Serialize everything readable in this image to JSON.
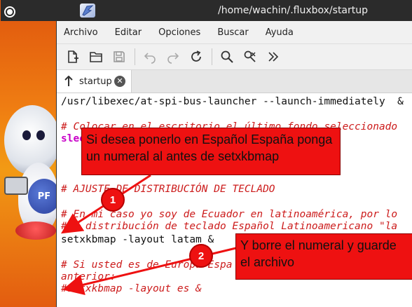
{
  "window": {
    "title": "/home/wachin/.fluxbox/startup"
  },
  "menubar": {
    "items": [
      "Archivo",
      "Editar",
      "Opciones",
      "Buscar",
      "Ayuda"
    ]
  },
  "toolbar": {
    "icons": [
      "new-file-icon",
      "open-folder-icon",
      "save-icon",
      "undo-icon",
      "redo-icon",
      "reload-icon",
      "search-icon",
      "find-replace-icon",
      "more-icon"
    ]
  },
  "tab": {
    "label": "startup",
    "close_glyph": "✕"
  },
  "editor": {
    "lines": [
      {
        "text": "/usr/libexec/at-spi-bus-launcher --launch-immediately  &",
        "style": "plain"
      },
      {
        "text": "",
        "style": "plain"
      },
      {
        "text": "# Colocar en el escritorio el último fondo seleccionado",
        "style": "comment"
      },
      {
        "text": "sleep",
        "style": "kw"
      },
      {
        "text": "",
        "style": "plain"
      },
      {
        "text": "",
        "style": "plain"
      },
      {
        "text": "",
        "style": "plain"
      },
      {
        "text": "# AJUSTE DE DISTRIBUCIÓN DE TECLADO",
        "style": "comment"
      },
      {
        "text": "",
        "style": "plain"
      },
      {
        "text": "# En mi caso yo soy de Ecuador en latinoamérica, por lo",
        "style": "comment"
      },
      {
        "text": "#la distribución de teclado Español Latinoamericano \"la",
        "style": "comment"
      },
      {
        "text": "setxkbmap -layout latam &",
        "style": "plain"
      },
      {
        "text": "",
        "style": "plain"
      },
      {
        "text": "# Si usted es de Europa Espa",
        "style": "comment"
      },
      {
        "text": "anterior:",
        "style": "comment"
      },
      {
        "text": "#setxkbmap -layout es &",
        "style": "comment"
      }
    ]
  },
  "annotations": {
    "callout_1": "Si desea ponerlo en Español España ponga un numeral al antes de setxkbmap",
    "callout_2": "Y borre el numeral y guarde el archivo",
    "badge_1": "1",
    "badge_2": "2",
    "color": "#ee1111"
  },
  "wallpaper": {
    "mascot_badge": "PF"
  }
}
